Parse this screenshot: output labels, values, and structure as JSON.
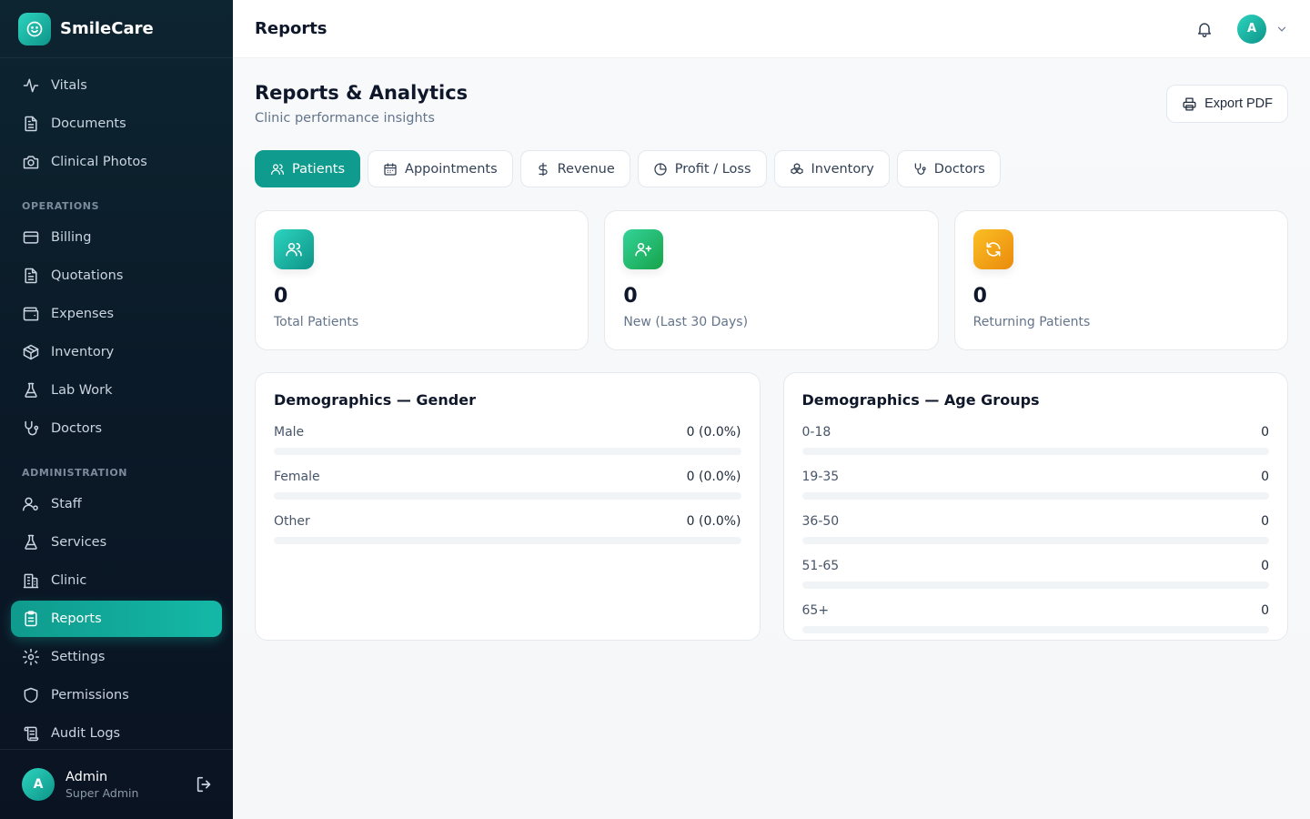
{
  "app": {
    "name": "SmileCare"
  },
  "sidebar": {
    "items_top": [
      {
        "label": "Vitals",
        "icon": "activity-icon"
      },
      {
        "label": "Documents",
        "icon": "file-text-icon"
      },
      {
        "label": "Clinical Photos",
        "icon": "camera-icon"
      }
    ],
    "section_operations": "OPERATIONS",
    "items_operations": [
      {
        "label": "Billing",
        "icon": "credit-card-icon"
      },
      {
        "label": "Quotations",
        "icon": "file-text-icon"
      },
      {
        "label": "Expenses",
        "icon": "wallet-icon"
      },
      {
        "label": "Inventory",
        "icon": "box-icon"
      },
      {
        "label": "Lab Work",
        "icon": "flask-icon"
      },
      {
        "label": "Doctors",
        "icon": "stethoscope-icon"
      }
    ],
    "section_admin": "ADMINISTRATION",
    "items_admin": [
      {
        "label": "Staff",
        "icon": "user-cog-icon"
      },
      {
        "label": "Services",
        "icon": "flask-icon"
      },
      {
        "label": "Clinic",
        "icon": "building-icon"
      },
      {
        "label": "Reports",
        "icon": "clipboard-icon",
        "active": true
      },
      {
        "label": "Settings",
        "icon": "gear-icon"
      },
      {
        "label": "Permissions",
        "icon": "shield-icon"
      },
      {
        "label": "Audit Logs",
        "icon": "scroll-icon"
      }
    ],
    "user": {
      "initial": "A",
      "name": "Admin",
      "role": "Super Admin"
    }
  },
  "topbar": {
    "title": "Reports",
    "avatar_initial": "A"
  },
  "page": {
    "title": "Reports & Analytics",
    "subtitle": "Clinic performance insights",
    "export_label": "Export PDF"
  },
  "tabs": [
    {
      "label": "Patients",
      "icon": "users-icon",
      "active": true
    },
    {
      "label": "Appointments",
      "icon": "calendar-icon"
    },
    {
      "label": "Revenue",
      "icon": "dollar-icon"
    },
    {
      "label": "Profit / Loss",
      "icon": "pie-chart-icon"
    },
    {
      "label": "Inventory",
      "icon": "boxes-icon"
    },
    {
      "label": "Doctors",
      "icon": "stethoscope-icon"
    }
  ],
  "stats": [
    {
      "value": "0",
      "label": "Total Patients",
      "icon": "users-icon",
      "color": "#14b8a6"
    },
    {
      "value": "0",
      "label": "New (Last 30 Days)",
      "icon": "user-plus-icon",
      "color": "#22c55e"
    },
    {
      "value": "0",
      "label": "Returning Patients",
      "icon": "refresh-icon",
      "color": "#f59e0b"
    }
  ],
  "gender": {
    "title": "Demographics — Gender",
    "rows": [
      {
        "label": "Male",
        "value": "0 (0.0%)",
        "fraction": 0
      },
      {
        "label": "Female",
        "value": "0 (0.0%)",
        "fraction": 0
      },
      {
        "label": "Other",
        "value": "0 (0.0%)",
        "fraction": 0
      }
    ]
  },
  "age": {
    "title": "Demographics — Age Groups",
    "rows": [
      {
        "label": "0-18",
        "value": "0",
        "fraction": 0
      },
      {
        "label": "19-35",
        "value": "0",
        "fraction": 0
      },
      {
        "label": "36-50",
        "value": "0",
        "fraction": 0
      },
      {
        "label": "51-65",
        "value": "0",
        "fraction": 0
      },
      {
        "label": "65+",
        "value": "0",
        "fraction": 0
      }
    ]
  },
  "colors": {
    "accent": "#14b8a6",
    "sidebar_bg": "#0b1a28"
  }
}
